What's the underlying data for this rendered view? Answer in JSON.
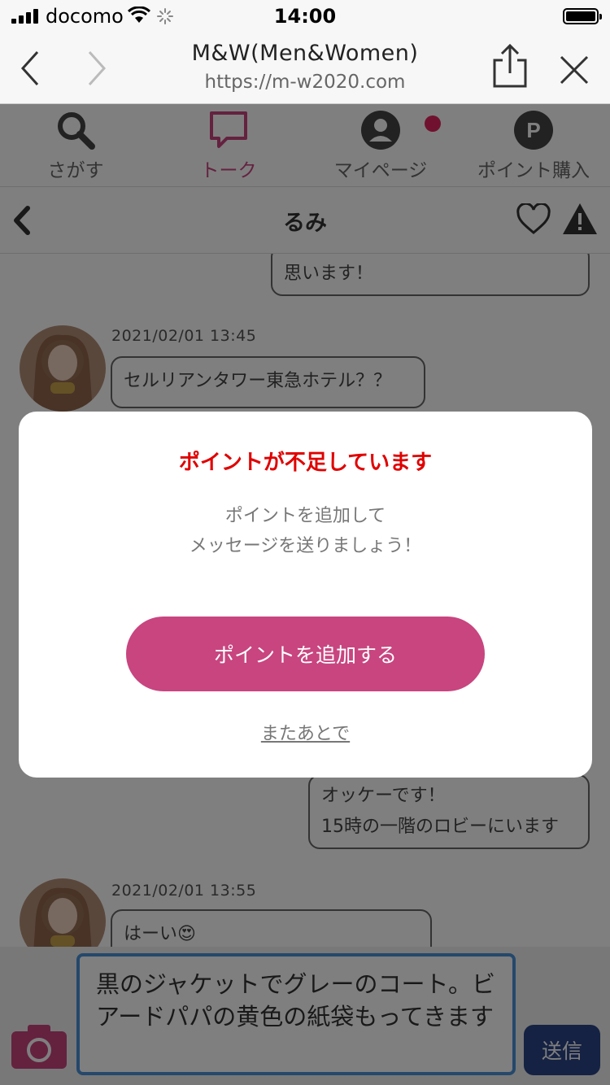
{
  "status_bar": {
    "carrier": "docomo",
    "time": "14:00"
  },
  "browser": {
    "title": "M&W(Men&Women)",
    "url": "https://m-w2020.com"
  },
  "nav": [
    {
      "label": "さがす",
      "icon": "search-icon"
    },
    {
      "label": "トーク",
      "icon": "chat-icon",
      "active": true
    },
    {
      "label": "マイページ",
      "icon": "person-icon",
      "badge": true
    },
    {
      "label": "ポイント購入",
      "icon": "point-icon"
    }
  ],
  "chat_header": {
    "name": "るみ"
  },
  "messages": [
    {
      "side": "right",
      "text": "思います！"
    },
    {
      "side": "left",
      "timestamp": "2021/02/01 13:45",
      "text": "セルリアンタワー東急ホテル？？"
    },
    {
      "side": "right",
      "lines": [
        "オッケーです！",
        "15時の一階のロビーにいます"
      ]
    },
    {
      "side": "left",
      "timestamp": "2021/02/01 13:55",
      "text": "はーい😍"
    }
  ],
  "composer": {
    "value": "黒のジャケットでグレーのコート。ビアードパパの黄色の紙袋もってきます",
    "send_label": "送信"
  },
  "modal": {
    "title": "ポイントが不足しています",
    "body_line1": "ポイントを追加して",
    "body_line2": "メッセージを送りましょう！",
    "add_button": "ポイントを追加する",
    "later_link": "またあとで"
  },
  "colors": {
    "accent": "#c8457f",
    "alert": "#e00000",
    "send": "#2b4486",
    "badge": "#e0245e"
  }
}
